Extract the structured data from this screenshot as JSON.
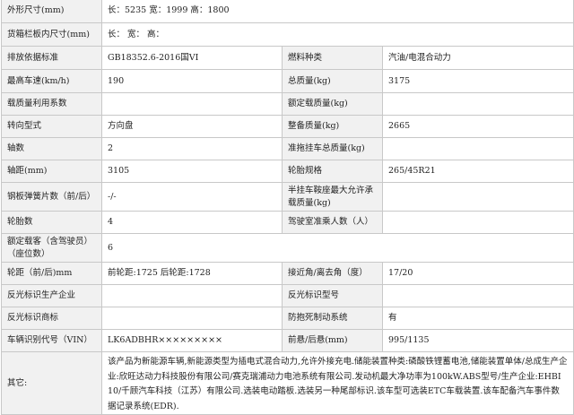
{
  "rows": [
    {
      "label1": "外形尺寸(mm)",
      "value1": "长：5235 宽：1999 高：1800",
      "span": true
    },
    {
      "label1": "货箱栏板内尺寸(mm)",
      "value1": "长： 宽： 高：",
      "span": true
    },
    {
      "label1": "排放依据标准",
      "value1": "GB18352.6-2016国VI",
      "label2": "燃料种类",
      "value2": "汽油/电混合动力"
    },
    {
      "label1": "最高车速(km/h)",
      "value1": "190",
      "label2": "总质量(kg)",
      "value2": "3175"
    },
    {
      "label1": "载质量利用系数",
      "value1": "",
      "label2": "额定载质量(kg)",
      "value2": ""
    },
    {
      "label1": "转向型式",
      "value1": "方向盘",
      "label2": "整备质量(kg)",
      "value2": "2665"
    },
    {
      "label1": "轴数",
      "value1": "2",
      "label2": "准拖挂车总质量(kg)",
      "value2": ""
    },
    {
      "label1": "轴距(mm)",
      "value1": "3105",
      "label2": "轮胎规格",
      "value2": "265/45R21"
    },
    {
      "label1": "钢板弹簧片数（前/后）",
      "value1": "-/-",
      "label2": "半挂车鞍座最大允许承载质量(kg)",
      "value2": ""
    },
    {
      "label1": "轮胎数",
      "value1": "4",
      "label2": "驾驶室准乘人数（人）",
      "value2": ""
    },
    {
      "label1": "额定载客（含驾驶员）（座位数）",
      "value1": "6",
      "span": true
    },
    {
      "label1": "轮距（前/后)mm",
      "value1": "前轮距:1725 后轮距:1728",
      "label2": "接近角/离去角（度）",
      "value2": "17/20"
    },
    {
      "label1": "反光标识生产企业",
      "value1": "",
      "label2": "反光标识型号",
      "value2": ""
    },
    {
      "label1": "反光标识商标",
      "value1": "",
      "label2": "防抱死制动系统",
      "value2": "有"
    },
    {
      "label1": "车辆识别代号（VIN）",
      "value1": "LK6ADBHR×××××××××",
      "label2": "前悬/后悬(mm)",
      "value2": "995/1135"
    }
  ],
  "other": {
    "label": "其它:",
    "text": "该产品为新能源车辆,新能源类型为插电式混合动力,允许外接充电.储能装置种类:磷酸铁锂蓄电池,储能装置单体/总成生产企业:欣旺达动力科技股份有限公司/赛克瑞浦动力电池系统有限公司.发动机最大净功率为100kW.ABS型号/生产企业:EHBI 10/千顾汽车科技（江苏）有限公司.选装电动踏板.选装另一种尾部标识.该车型可选装ETC车载装置.该车配备汽车事件数据记录系统(EDR)."
  }
}
